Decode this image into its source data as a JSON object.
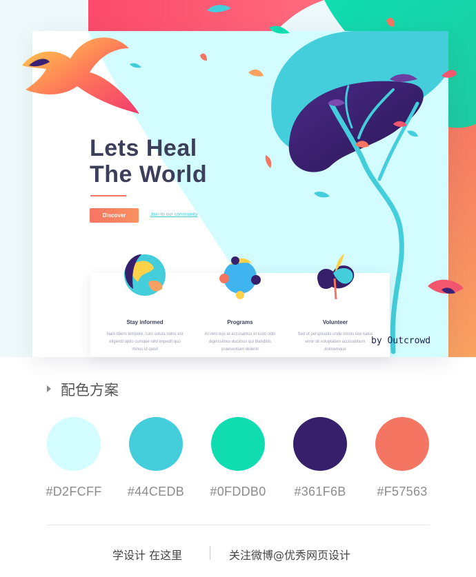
{
  "hero": {
    "title_line1": "Lets Heal",
    "title_line2": "The World",
    "discover_label": "Discover",
    "join_label": "Join to our community",
    "credit": "by Outcrowd"
  },
  "features": [
    {
      "title": "Stay informed",
      "text": "Nam libero tempore, cum soluta nobis est eligendi optio cumque nihil impedit quo minus id quod"
    },
    {
      "title": "Programs",
      "text": "At vero eos et accusamus et iusto odio dignissimos ducimus qui blanditiis praesentium deleniti"
    },
    {
      "title": "Volunteer",
      "text": "Sed ut perspiciatis unde omnis iste natus error sit voluptatem accusantium doloremque"
    }
  ],
  "palette": {
    "title": "配色方案",
    "colors": [
      {
        "hex": "#D2FCFF",
        "value": "#D2FCFF"
      },
      {
        "hex": "#44CEDB",
        "value": "#44CEDB"
      },
      {
        "hex": "#0FDDB0",
        "value": "#0FDDB0"
      },
      {
        "hex": "#361F6B",
        "value": "#361F6B"
      },
      {
        "hex": "#F57563",
        "value": "#F57563"
      }
    ]
  },
  "footer": {
    "left": "学设计  在这里",
    "right": "关注微博@优秀网页设计"
  }
}
